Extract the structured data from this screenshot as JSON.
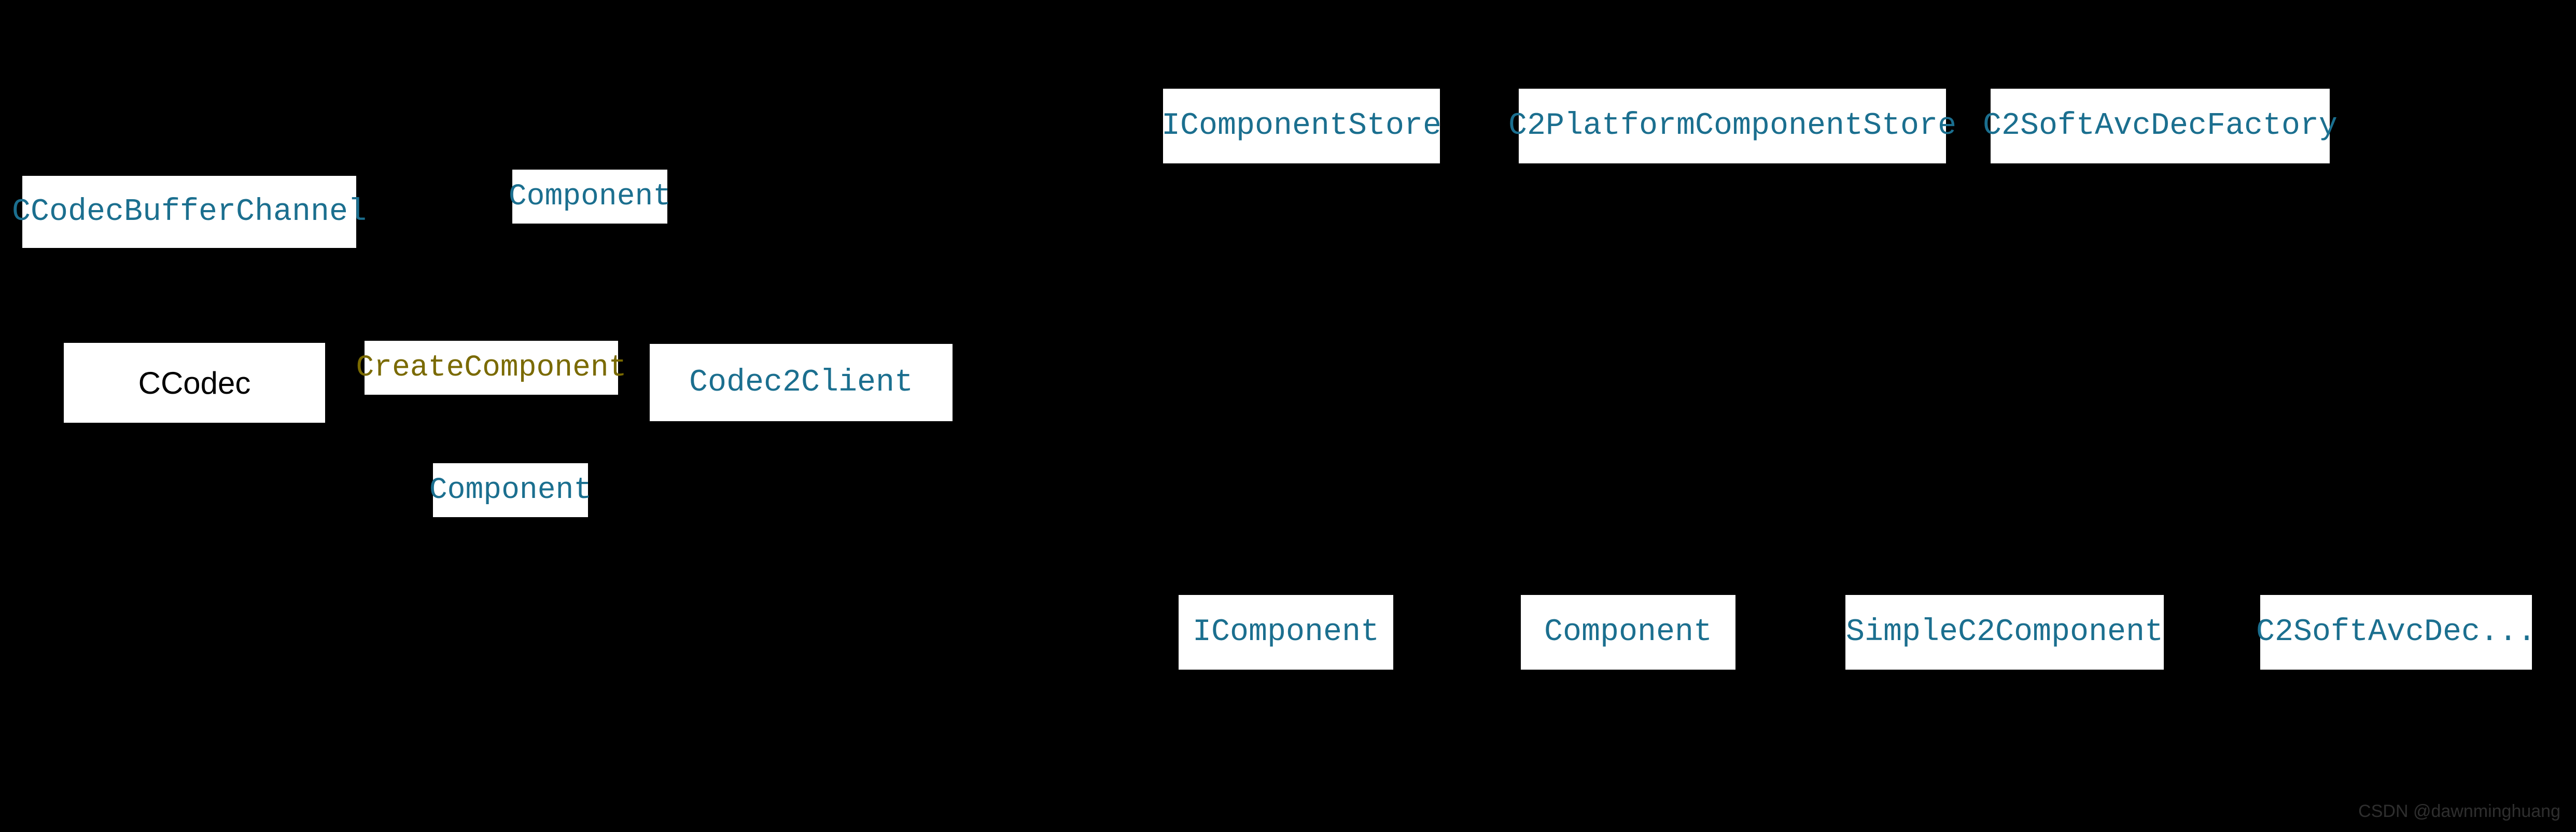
{
  "colors": {
    "bg": "#000000",
    "node_bg": "#FFFFFF",
    "teal": "#1B6F8F",
    "olive": "#7A6A00",
    "black": "#000000"
  },
  "nodes": {
    "ccodec_buffer_channel": "CCodecBufferChannel",
    "component_top": "Component",
    "ccodec": "CCodec",
    "create_component": "CreateComponent",
    "codec2_client": "Codec2Client",
    "component_bottom": "Component",
    "icomponent_store": "IComponentStore",
    "c2_platform_component_store": "C2PlatformComponentStore",
    "c2_soft_avc_dec_factory": "C2SoftAvcDecFactory",
    "icomponent": "IComponent",
    "component_right": "Component",
    "simple_c2_component": "SimpleC2Component",
    "c2_soft_avc_dec": "C2SoftAvcDec..."
  },
  "watermark": "CSDN @dawnminghuang"
}
